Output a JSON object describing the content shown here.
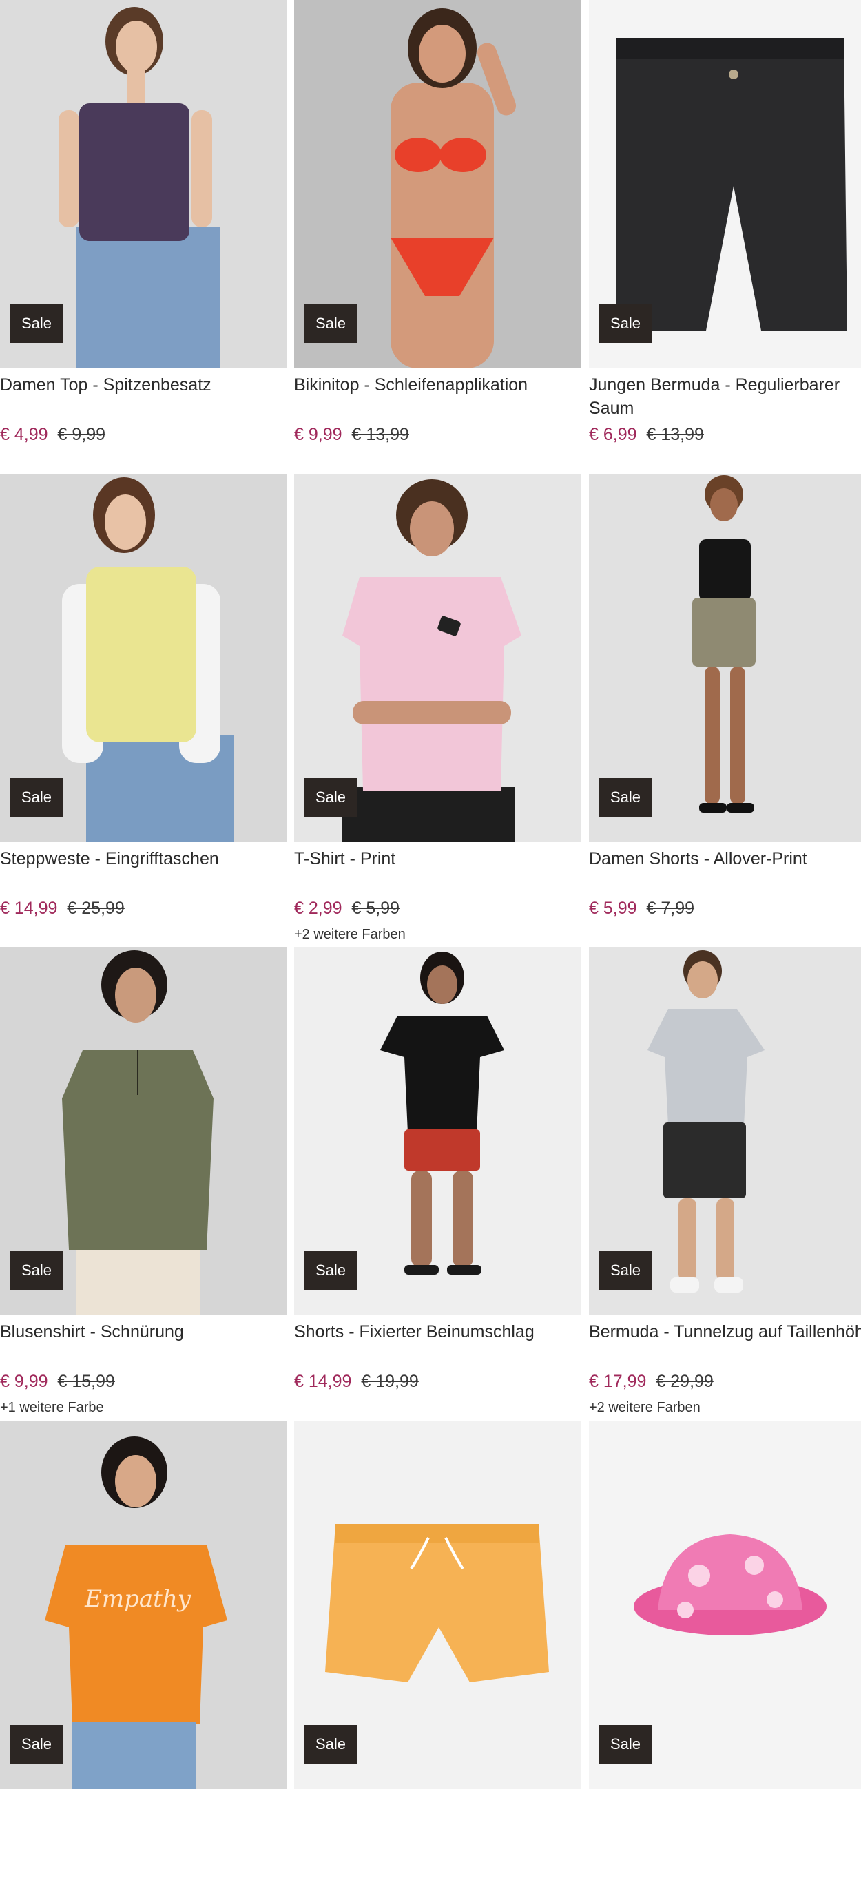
{
  "sale_label": "Sale",
  "accent_color": "#a0295b",
  "badge_color": "#2c2623",
  "products": [
    {
      "title": "Damen Top - Spitzenbesatz",
      "price": "€ 4,99",
      "old_price": "€ 9,99",
      "colors_note": "",
      "image": "woman-floral-camisole-jeans"
    },
    {
      "title": "Bikinitop - Schleifenapplikation",
      "price": "€ 9,99",
      "old_price": "€ 13,99",
      "colors_note": "",
      "image": "woman-red-bikini"
    },
    {
      "title": "Jungen Bermuda - Regulierbarer Saum",
      "price": "€ 6,99",
      "old_price": "€ 13,99",
      "colors_note": "",
      "image": "black-denim-bermuda"
    },
    {
      "title": "Steppweste - Eingrifftaschen",
      "price": "€ 14,99",
      "old_price": "€ 25,99",
      "colors_note": "",
      "image": "woman-yellow-quilted-vest"
    },
    {
      "title": "T-Shirt - Print",
      "price": "€ 2,99",
      "old_price": "€ 5,99",
      "colors_note": "+2 weitere Farben",
      "image": "woman-pink-tshirt"
    },
    {
      "title": "Damen Shorts - Allover-Print",
      "price": "€ 5,99",
      "old_price": "€ 7,99",
      "colors_note": "",
      "image": "woman-printed-shorts-black-tank"
    },
    {
      "title": "Blusenshirt - Schnürung",
      "price": "€ 9,99",
      "old_price": "€ 15,99",
      "colors_note": "+1 weitere Farbe",
      "image": "woman-olive-blouse"
    },
    {
      "title": "Shorts - Fixierter Beinumschlag",
      "price": "€ 14,99",
      "old_price": "€ 19,99",
      "colors_note": "",
      "image": "woman-red-shorts-black-top"
    },
    {
      "title": "Bermuda - Tunnelzug auf Taillenhöhe",
      "price": "€ 17,99",
      "old_price": "€ 29,99",
      "colors_note": "+2 weitere Farben",
      "image": "man-grey-shirt-black-bermuda"
    },
    {
      "title": "",
      "price": "",
      "old_price": "",
      "colors_note": "",
      "image": "woman-orange-print-tshirt"
    },
    {
      "title": "",
      "price": "",
      "old_price": "",
      "colors_note": "",
      "image": "orange-shorts"
    },
    {
      "title": "",
      "price": "",
      "old_price": "",
      "colors_note": "",
      "image": "pink-floral-bucket-hat"
    }
  ]
}
